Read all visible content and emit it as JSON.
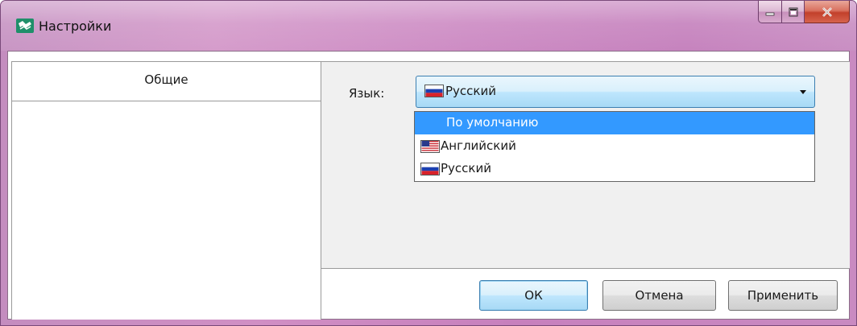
{
  "window": {
    "title": "Настройки",
    "icon": "app-logo-icon"
  },
  "titlebar_buttons": {
    "minimize": "minimize-icon",
    "maximize": "maximize-icon",
    "close": "close-icon"
  },
  "tabs": [
    {
      "label": "Общие",
      "selected": true
    }
  ],
  "language": {
    "label": "Язык:",
    "selected_value": "Русский",
    "selected_flag": "flag-ru-icon",
    "options": [
      {
        "label": "По умолчанию",
        "flag": null,
        "highlighted": true
      },
      {
        "label": "Английский",
        "flag": "flag-us-icon",
        "highlighted": false
      },
      {
        "label": "Русский",
        "flag": "flag-ru-icon",
        "highlighted": false
      }
    ]
  },
  "buttons": {
    "ok": "ОК",
    "cancel": "Отмена",
    "apply": "Применить"
  },
  "colors": {
    "titlebar": "#c98ac1",
    "highlight": "#3399ff",
    "combo_border": "#3c7fb1"
  }
}
